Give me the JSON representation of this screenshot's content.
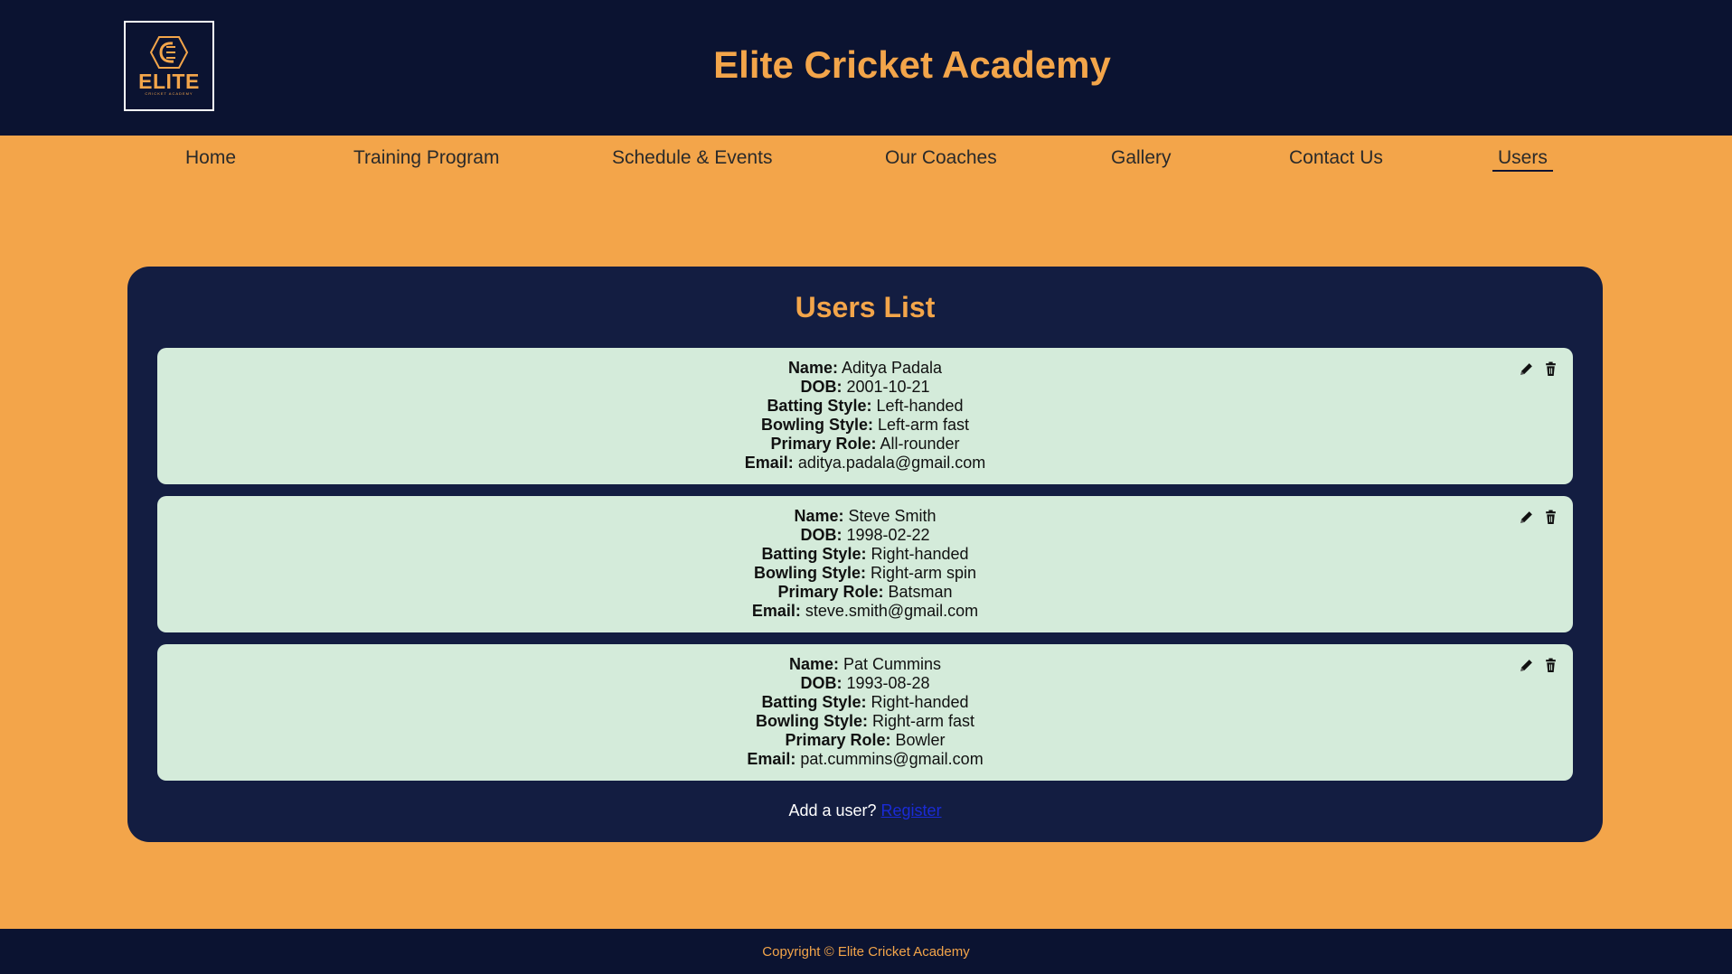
{
  "header": {
    "logo_text": "ELITE",
    "logo_subtext": "CRICKET ACADEMY",
    "title": "Elite Cricket Academy"
  },
  "nav": {
    "items": [
      {
        "label": "Home"
      },
      {
        "label": "Training Program"
      },
      {
        "label": "Schedule & Events"
      },
      {
        "label": "Our Coaches"
      },
      {
        "label": "Gallery"
      },
      {
        "label": "Contact Us"
      },
      {
        "label": "Users",
        "active": true
      }
    ]
  },
  "users_panel": {
    "title": "Users List",
    "labels": {
      "name": "Name:",
      "dob": "DOB:",
      "batting": "Batting Style:",
      "bowling": "Bowling Style:",
      "role": "Primary Role:",
      "email": "Email:"
    },
    "users": [
      {
        "name": "Aditya Padala",
        "dob": "2001-10-21",
        "batting": "Left-handed",
        "bowling": "Left-arm fast",
        "role": "All-rounder",
        "email": "aditya.padala@gmail.com"
      },
      {
        "name": "Steve Smith",
        "dob": "1998-02-22",
        "batting": "Right-handed",
        "bowling": "Right-arm spin",
        "role": "Batsman",
        "email": "steve.smith@gmail.com"
      },
      {
        "name": "Pat Cummins",
        "dob": "1993-08-28",
        "batting": "Right-handed",
        "bowling": "Right-arm fast",
        "role": "Bowler",
        "email": "pat.cummins@gmail.com"
      }
    ],
    "actions": {
      "edit_icon": "pencil-icon",
      "delete_icon": "trash-icon"
    },
    "add_user_prompt": "Add a user?",
    "register_link": "Register"
  },
  "footer": {
    "copyright": "Copyright © Elite Cricket Academy"
  },
  "colors": {
    "accent": "#f3a54a",
    "header_bg": "#0b1331",
    "panel_bg": "#131d41",
    "card_bg": "#d4ebda",
    "link": "#1a2bd6"
  }
}
